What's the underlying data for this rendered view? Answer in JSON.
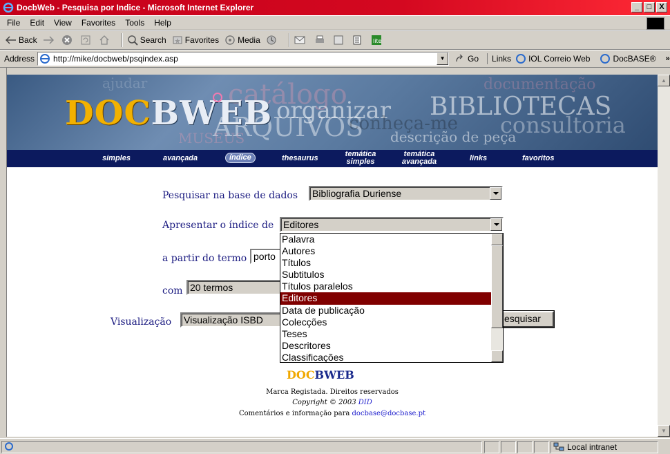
{
  "window": {
    "title": "DocbWeb - Pesquisa por Indice - Microsoft Internet Explorer",
    "controls": [
      "_",
      "□",
      "X"
    ]
  },
  "menu": [
    "File",
    "Edit",
    "View",
    "Favorites",
    "Tools",
    "Help"
  ],
  "toolbar": {
    "back": "Back",
    "search": "Search",
    "favorites": "Favorites",
    "media": "Media"
  },
  "address": {
    "label": "Address",
    "url": "http://mike/docbweb/psqindex.asp",
    "go": "Go",
    "links_label": "Links",
    "link1": "IOL Correio Web",
    "link2": "DocBASE®"
  },
  "banner": {
    "logo_left": "DOC",
    "logo_right": "BWEB",
    "words": [
      "ajudar",
      "catálogo",
      "organizar",
      "BIBLIOTECAS",
      "consultoria",
      "ARQUIVOS",
      "conheça-me",
      "descrição de peça",
      "MUSEUS",
      "documentação"
    ]
  },
  "nav": {
    "items": [
      "simples",
      "avançada",
      "índice",
      "thesaurus",
      "temática simples",
      "temática avançada",
      "links",
      "favoritos"
    ],
    "active": "índice"
  },
  "form": {
    "base_label": "Pesquisar na base de dados",
    "base_value": "Bibliografia Duriense",
    "indice_label": "Apresentar o índice de",
    "indice_value": "Editores",
    "termo_label": "a partir do termo",
    "termo_value": "porto",
    "com_label": "com",
    "com_value": "20 termos",
    "vis_label": "Visualização",
    "vis_value": "Visualização ISBD",
    "submit_label": "esquisar"
  },
  "dropdown": {
    "options": [
      "Palavra",
      "Autores",
      "Títulos",
      "Subtitulos",
      "Títulos paralelos",
      "Editores",
      "Data de publicação",
      "Colecções",
      "Teses",
      "Descritores",
      "Classificações"
    ],
    "selected": "Editores"
  },
  "footer": {
    "logo_left": "DOC",
    "logo_right": "BWEB",
    "line1": "Marca Registada. Direitos reservados",
    "copyright": "Copyright © 2003",
    "did": "DID",
    "contact_text": "Comentários e informação para",
    "email": "docbase@docbase.pt"
  },
  "status": {
    "zone": "Local intranet"
  },
  "colors": {
    "titlebar": "#c4001a",
    "nav_bg": "#0c1a5e",
    "label": "#1a1a80",
    "selected": "#800000"
  }
}
